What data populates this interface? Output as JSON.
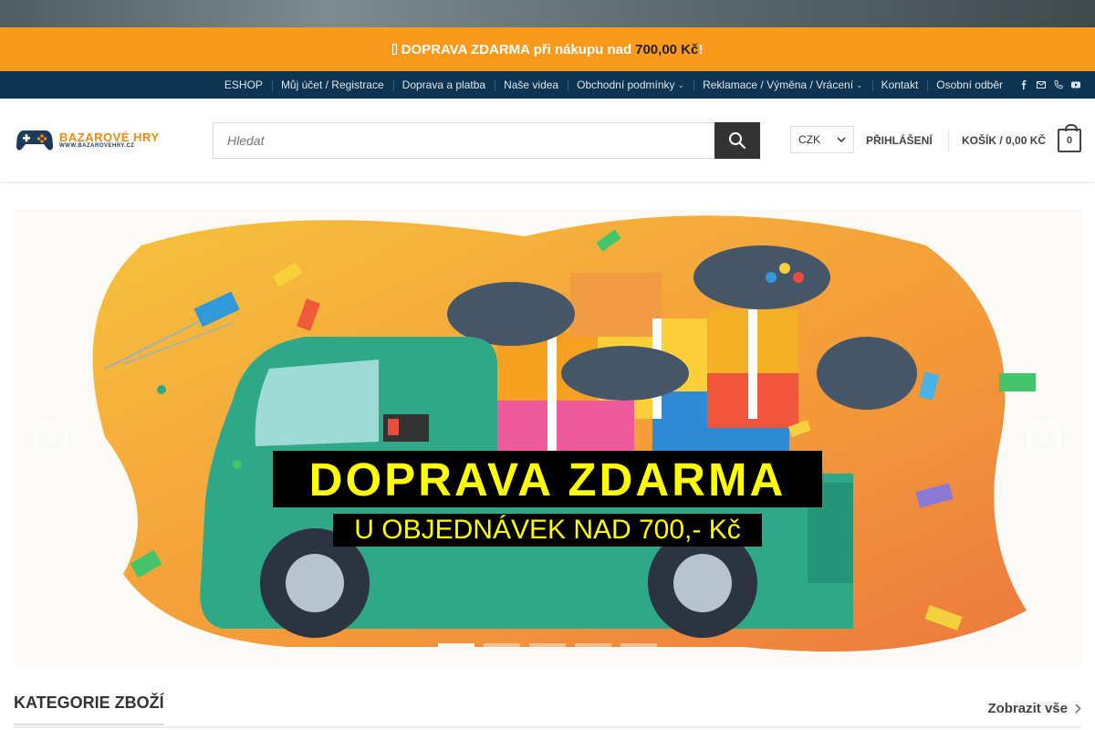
{
  "promo": {
    "icon": "truck-icon",
    "text": "DOPRAVA ZDARMA při nákupu nad",
    "amount": "700,00 Kč",
    "suffix": "!"
  },
  "topnav": {
    "items": [
      {
        "label": "ESHOP",
        "dropdown": false
      },
      {
        "label": "Můj účet / Registrace",
        "dropdown": false
      },
      {
        "label": "Doprava a platba",
        "dropdown": false
      },
      {
        "label": "Naše videa",
        "dropdown": false
      },
      {
        "label": "Obchodní podmínky",
        "dropdown": true
      },
      {
        "label": "Reklamace / Výměna / Vrácení",
        "dropdown": true
      },
      {
        "label": "Kontakt",
        "dropdown": false
      },
      {
        "label": "Osobní odběr",
        "dropdown": false
      }
    ],
    "icons": [
      "facebook-icon",
      "envelope-icon",
      "phone-icon",
      "youtube-icon"
    ]
  },
  "header": {
    "logo": {
      "name": "BAZAROVÉ HRY",
      "url": "WWW.BAZAROVEHRY.CZ"
    },
    "search": {
      "placeholder": "Hledat"
    },
    "currency": "CZK",
    "login": "PŘIHLÁŠENÍ",
    "cart_label": "KOŠÍK / 0,00 KČ",
    "cart_count": "0"
  },
  "slider": {
    "title": "DOPRAVA ZDARMA",
    "subtitle": "U OBJEDNÁVEK NAD 700,- Kč",
    "slide_count": 5,
    "active_slide": 1
  },
  "section": {
    "title": "KATEGORIE ZBOŽÍ",
    "view_all": "Zobrazit vše"
  },
  "colors": {
    "promo": "#f99a1c",
    "nav": "#0d3552",
    "slide_text": "#ffff00",
    "truck": "#2ea887"
  }
}
